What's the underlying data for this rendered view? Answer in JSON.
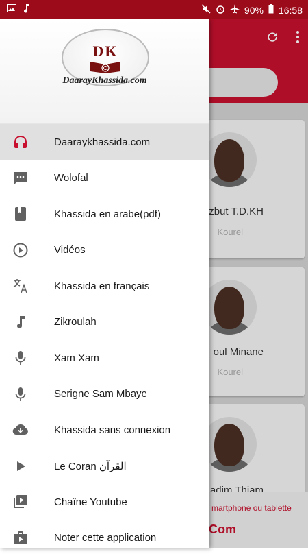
{
  "status_bar": {
    "battery": "90%",
    "time": "16:58"
  },
  "drawer": {
    "logo_text": "DK",
    "logo_site": "DaarayKhassida.com",
    "items": [
      {
        "label": "Daaraykhassida.com",
        "icon": "headphones-icon",
        "active": true
      },
      {
        "label": "Wolofal",
        "icon": "chat-bubble-icon"
      },
      {
        "label": "Khassida en arabe(pdf)",
        "icon": "book-icon"
      },
      {
        "label": "Vidéos",
        "icon": "play-circle-icon"
      },
      {
        "label": "Khassida en français",
        "icon": "translate-icon"
      },
      {
        "label": "Zikroulah",
        "icon": "music-note-icon"
      },
      {
        "label": "Xam Xam",
        "icon": "microphone-icon"
      },
      {
        "label": "Serigne Sam Mbaye",
        "icon": "microphone-icon"
      },
      {
        "label": "Khassida sans connexion",
        "icon": "cloud-download-icon"
      },
      {
        "label": "Le Coran القرآن",
        "icon": "play-arrow-icon"
      },
      {
        "label": "Chaîne Youtube",
        "icon": "video-library-icon"
      },
      {
        "label": "Noter cette application",
        "icon": "shop-icon"
      }
    ]
  },
  "cards": [
    {
      "name": "zbut T.D.KH",
      "sub": "Kourel"
    },
    {
      "name": "oul Minane",
      "sub": "Kourel"
    },
    {
      "name": "adim Thiam",
      "sub": ""
    }
  ],
  "banner": {
    "line1": "martphone ou tablette",
    "line2": "Com"
  },
  "colors": {
    "primary": "#c8102e",
    "status": "#9c0b1a"
  }
}
